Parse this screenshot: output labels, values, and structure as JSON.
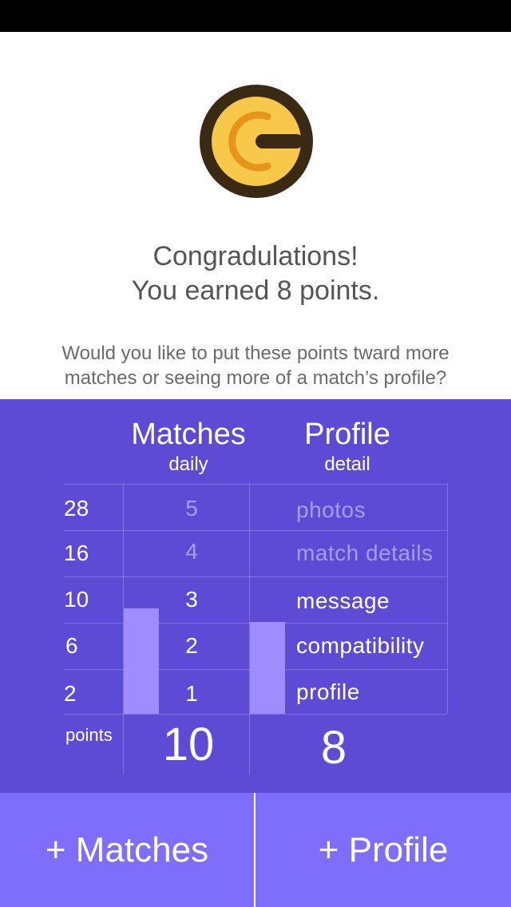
{
  "icons": {
    "logo": "coin-logo-icon"
  },
  "colors": {
    "panel": "#5d4bd6",
    "bar": "#9f8cff",
    "button": "#7f6dfb",
    "logo_ring": "#3a2a14",
    "logo_gold": "#f5c040"
  },
  "header": {
    "title_line1": "Congradulations!",
    "title_line2": "You earned 8 points.",
    "question_line1": "Would you like to put these points tward more",
    "question_line2": "matches or seeing more of a match’s profile?"
  },
  "table": {
    "matches_title": "Matches",
    "matches_subtitle": "daily",
    "profile_title": "Profile",
    "profile_subtitle": "detail",
    "rows": [
      {
        "points": "28",
        "matches": "5",
        "profile": "photos"
      },
      {
        "points": "16",
        "matches": "4",
        "profile": "match details"
      },
      {
        "points": "10",
        "matches": "3",
        "profile": "message"
      },
      {
        "points": "6",
        "matches": "2",
        "profile": "compatibility"
      },
      {
        "points": "2",
        "matches": "1",
        "profile": "profile"
      }
    ],
    "points_label": "points",
    "matches_total": "10",
    "profile_total": "8",
    "matches_level_rows": 2.3,
    "profile_level_rows": 2
  },
  "buttons": {
    "matches": "+ Matches",
    "profile": "+ Profile"
  }
}
